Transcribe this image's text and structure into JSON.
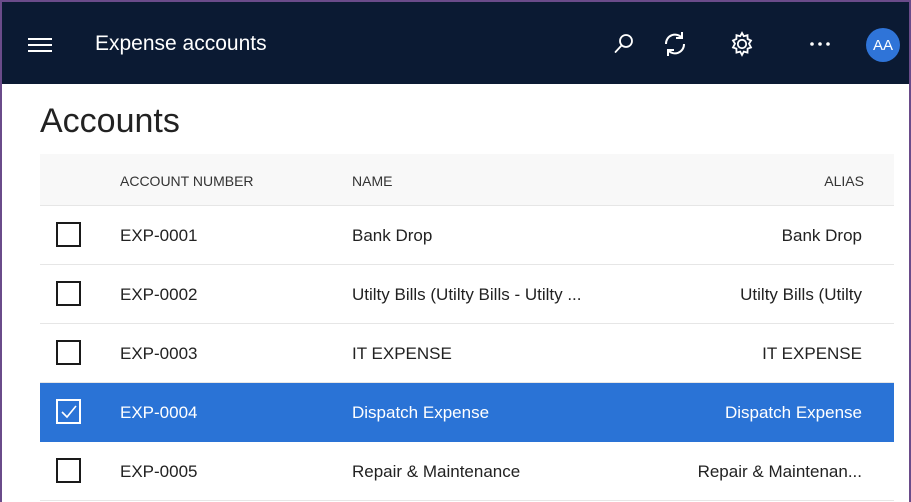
{
  "header": {
    "title": "Expense accounts",
    "avatar_initials": "AA",
    "icons": [
      "hamburger-menu-icon",
      "search-icon",
      "refresh-icon",
      "gear-icon",
      "more-icon"
    ],
    "background_color": "#0b1a33",
    "avatar_color": "#2f74d8"
  },
  "page": {
    "title": "Accounts"
  },
  "grid": {
    "columns": {
      "account_number": "ACCOUNT NUMBER",
      "name": "NAME",
      "alias": "ALIAS"
    },
    "rows": [
      {
        "account_number": "EXP-0001",
        "name": "Bank Drop",
        "alias": "Bank Drop",
        "selected": false
      },
      {
        "account_number": "EXP-0002",
        "name": "Utilty Bills (Utilty Bills - Utilty ...",
        "alias": "Utilty Bills (Utilty",
        "selected": false
      },
      {
        "account_number": "EXP-0003",
        "name": "IT EXPENSE",
        "alias": "IT EXPENSE",
        "selected": false
      },
      {
        "account_number": "EXP-0004",
        "name": "Dispatch Expense",
        "alias": "Dispatch Expense",
        "selected": true
      },
      {
        "account_number": "EXP-0005",
        "name": "Repair & Maintenance",
        "alias": "Repair & Maintenan...",
        "selected": false
      }
    ],
    "selected_color": "#2a73d6"
  }
}
